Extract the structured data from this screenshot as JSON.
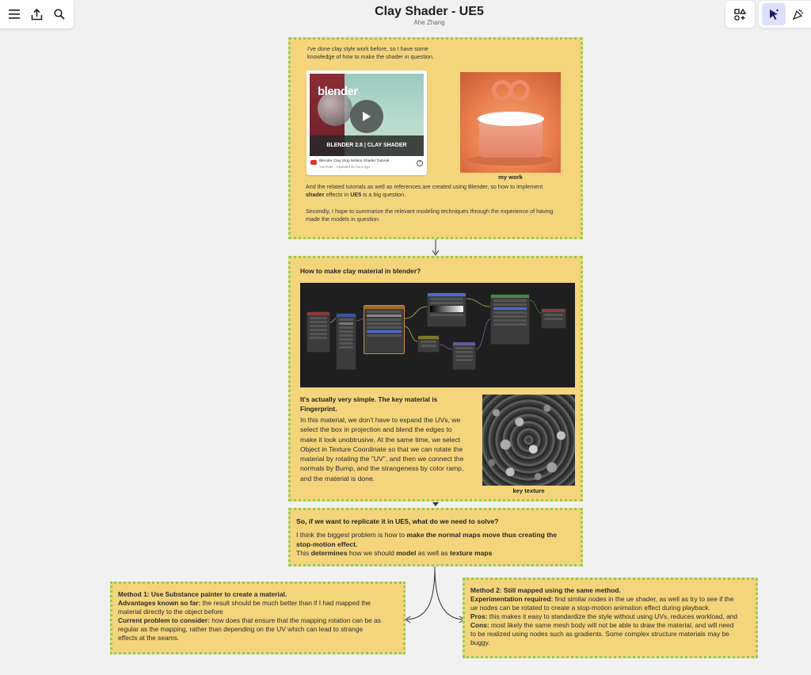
{
  "board": {
    "title": "Clay Shader - UE5",
    "author": "Ahe Zhang"
  },
  "card1": {
    "intro": [
      "I've done clay style work before, so I have some",
      "knowledge of how to make the shader in question."
    ],
    "video": {
      "brand": "blender",
      "thumb_caption": "BLENDER 2.8 | CLAY SHADER",
      "title": "Blender Clay Stop Motion Shader Tutorial",
      "meta": "YouTube · Updated an hour ago"
    },
    "image_caption": "my work",
    "para1_a": "And the related tutorials as well as references are created using Blender, so how to implement",
    "para1_b_bold1": "shader",
    "para1_b_mid": " effects in ",
    "para1_b_bold2": "UE5",
    "para1_b_end": " is a big question.",
    "para2": [
      "Secondly, I hope to summarize the relevant modeling techniques through the experience of having",
      "made the models in question."
    ]
  },
  "card2": {
    "heading": "How to make clay material in blender?",
    "sub_bold": [
      "It's actually very simple. The key material is",
      "Fingerprint."
    ],
    "body": [
      "In this material, we don't have to expand the UVs, we",
      "select the box in projection and blend the edges to",
      "make it look unobtrusive. At the same time, we select",
      "Object in Texture Coordinate so that we can rotate the",
      "material by rotating the \"UV\", and then we connect the",
      "normals by Bump, and the strangeness by color ramp,",
      "and the material is done."
    ],
    "image_caption": "key texture"
  },
  "card3": {
    "heading": "So, if we want to replicate it in UE5, what do we need to solve?",
    "l1_a": "I think the biggest problem is how to ",
    "l1_b": "make the normal maps move thus creating the",
    "l2_b": "stop-motion effect.",
    "l3_a": "This ",
    "l3_b": "determines",
    "l3_c": " how we should ",
    "l3_d": "model",
    "l3_e": " as well as ",
    "l3_f": "texture maps"
  },
  "card4": {
    "heading": "Method 1: Use Substance painter to create a material.",
    "adv_label": "Advantages known so far:",
    "adv_text": " the result should be much better than if I had mapped the",
    "adv_text2": "material directly to the object before",
    "prob_label": "Current problem to consider:",
    "prob_text": " how does that ensure that the mapping rotation can be as",
    "prob_text2": "regular as the mapping, rather than depending on the UV which can lead to strange",
    "prob_text3": "effects at the seams."
  },
  "card5": {
    "heading": "Method 2: Still mapped using the same method.",
    "exp_label": "Experimentation required:",
    "exp_text": " find similar nodes in the ue shader, as well as try to see if the",
    "exp_text2": "ue nodes can be rotated to create a stop-motion animation effect during playback.",
    "pros_label": "Pros:",
    "pros_text": " this makes it easy to standardize the style without using UVs, reduces workload, and",
    "cons_label": "Cons:",
    "cons_text": " most likely the same mesh body will not be able to draw the material, and will need",
    "cons_text2": "to be realized using nodes such as gradients. Some complex structure materials may be",
    "cons_text3": "buggy."
  },
  "colors": {
    "card": "#f5d57c",
    "border": "#94cc5c",
    "accent": "#4262ff"
  },
  "icons": [
    "menu-icon",
    "share-icon",
    "search-icon",
    "shapes-icon",
    "select-cursor-icon",
    "reactions-icon"
  ]
}
